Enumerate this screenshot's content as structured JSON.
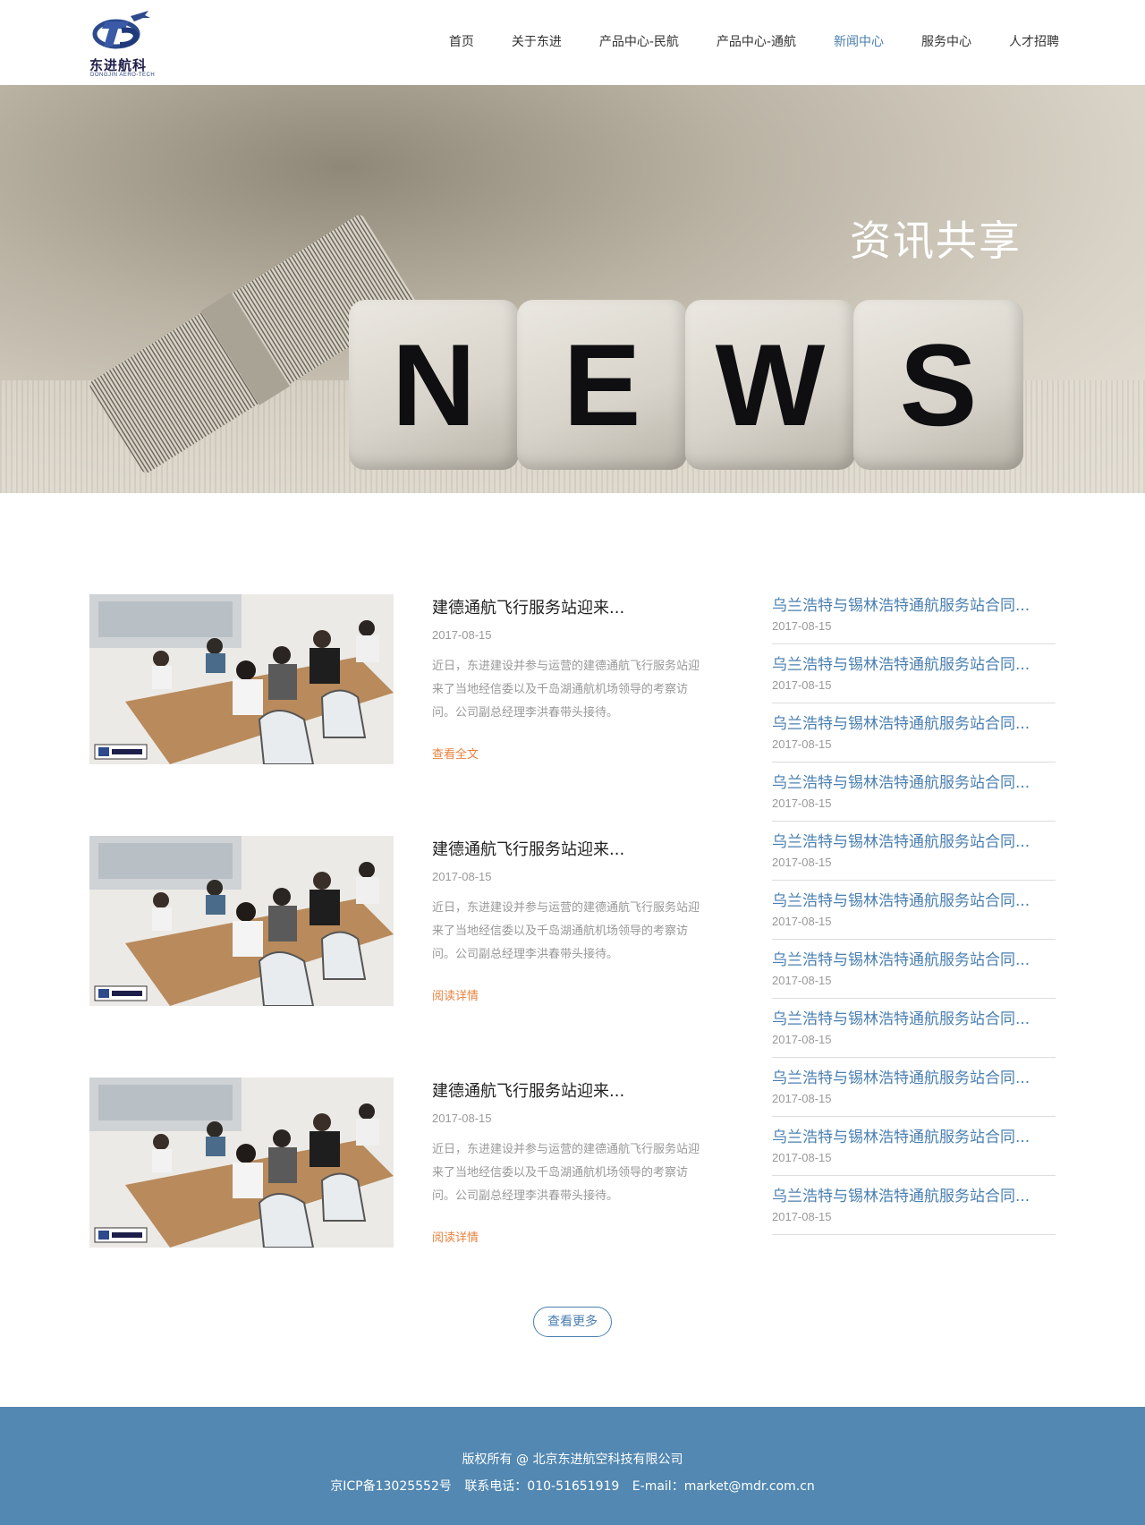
{
  "brand": {
    "name": "东进航科",
    "sub": "DONGJIN AERO-TECH"
  },
  "nav": [
    {
      "label": "首页"
    },
    {
      "label": "关于东进"
    },
    {
      "label": "产品中心-民航"
    },
    {
      "label": "产品中心-通航"
    },
    {
      "label": "新闻中心"
    },
    {
      "label": "服务中心"
    },
    {
      "label": "人才招聘"
    }
  ],
  "nav_active": "新闻中心",
  "banner": {
    "title": "资讯共享",
    "letters": [
      "N",
      "E",
      "W",
      "S"
    ]
  },
  "articles": [
    {
      "title": "建德通航飞行服务站迎来...",
      "date": "2017-08-15",
      "desc": "近日，东进建设并参与运营的建德通航飞行服务站迎来了当地经信委以及千岛湖通航机场领导的考察访问。公司副总经理李洪春带头接待。",
      "link": "查看全文"
    },
    {
      "title": "建德通航飞行服务站迎来...",
      "date": "2017-08-15",
      "desc": "近日，东进建设并参与运营的建德通航飞行服务站迎来了当地经信委以及千岛湖通航机场领导的考察访问。公司副总经理李洪春带头接待。",
      "link": "阅读详情"
    },
    {
      "title": "建德通航飞行服务站迎来...",
      "date": "2017-08-15",
      "desc": "近日，东进建设并参与运营的建德通航飞行服务站迎来了当地经信委以及千岛湖通航机场领导的考察访问。公司副总经理李洪春带头接待。",
      "link": "阅读详情"
    }
  ],
  "side_list": [
    {
      "title": "乌兰浩特与锡林浩特通航服务站合同...",
      "date": "2017-08-15"
    },
    {
      "title": "乌兰浩特与锡林浩特通航服务站合同...",
      "date": "2017-08-15"
    },
    {
      "title": "乌兰浩特与锡林浩特通航服务站合同...",
      "date": "2017-08-15"
    },
    {
      "title": "乌兰浩特与锡林浩特通航服务站合同...",
      "date": "2017-08-15"
    },
    {
      "title": "乌兰浩特与锡林浩特通航服务站合同...",
      "date": "2017-08-15"
    },
    {
      "title": "乌兰浩特与锡林浩特通航服务站合同...",
      "date": "2017-08-15"
    },
    {
      "title": "乌兰浩特与锡林浩特通航服务站合同...",
      "date": "2017-08-15"
    },
    {
      "title": "乌兰浩特与锡林浩特通航服务站合同...",
      "date": "2017-08-15"
    },
    {
      "title": "乌兰浩特与锡林浩特通航服务站合同...",
      "date": "2017-08-15"
    },
    {
      "title": "乌兰浩特与锡林浩特通航服务站合同...",
      "date": "2017-08-15"
    },
    {
      "title": "乌兰浩特与锡林浩特通航服务站合同...",
      "date": "2017-08-15"
    }
  ],
  "more_label": "查看更多",
  "footer": {
    "copyright": "版权所有 @ 北京东进航空科技有限公司",
    "icp": "京ICP备13025552号",
    "phone": "联系电话：010-51651919",
    "email": "E-mail：market@mdr.com.cn"
  },
  "colors": {
    "accent": "#4a7fb0",
    "link_orange": "#e8823e",
    "footer_bg": "#5288b2"
  }
}
